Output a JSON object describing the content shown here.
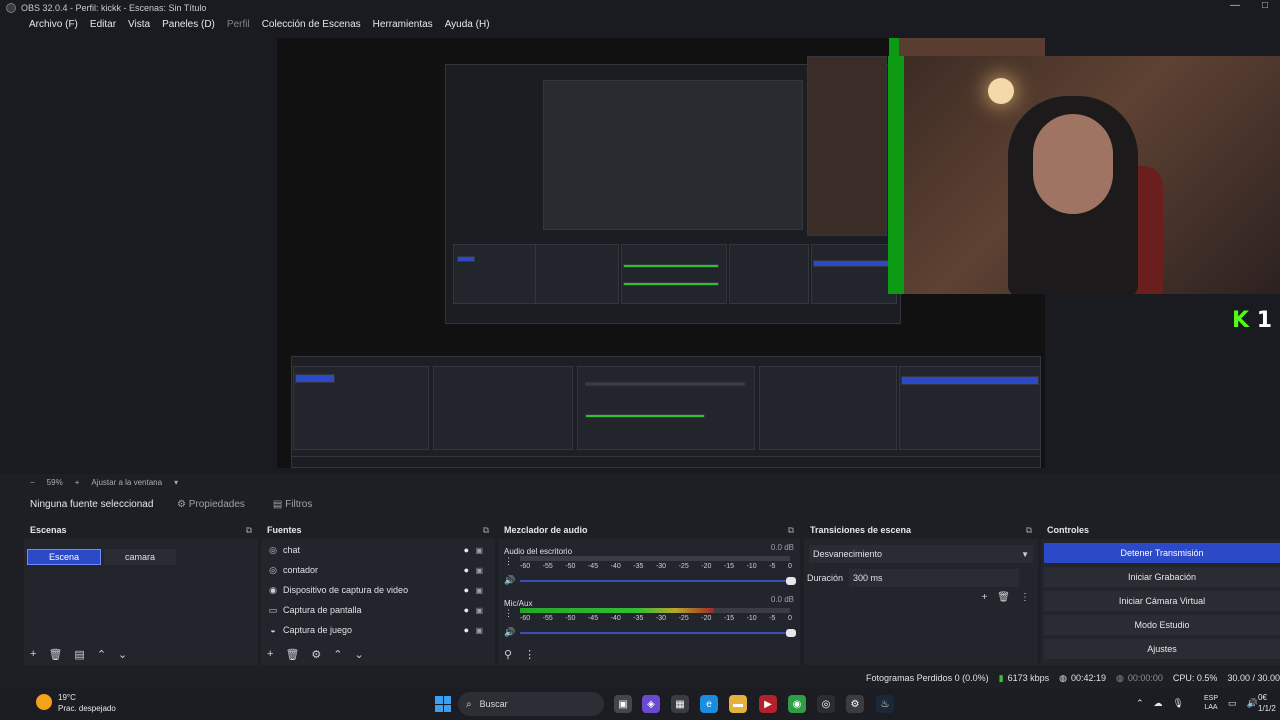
{
  "window": {
    "title": "OBS 32.0.4 - Perfil: kickk - Escenas: Sin Título"
  },
  "menu": [
    "Archivo (F)",
    "Editar",
    "Vista",
    "Paneles (D)",
    "Perfil",
    "Colección de Escenas",
    "Herramientas",
    "Ayuda (H)"
  ],
  "preview": {
    "overlay_logo_k": "K",
    "overlay_logo_num": "1"
  },
  "zoom": {
    "minus": "−",
    "percent": "59%",
    "plus": "+",
    "fit": "Ajustar a la ventana",
    "dropdown": "▾"
  },
  "source_toolbar": {
    "no_source": "Ninguna fuente seleccionad",
    "properties": "Propiedades",
    "filters": "Filtros"
  },
  "docks": {
    "scenes": {
      "title": "Escenas",
      "items": [
        "Escena",
        "camara"
      ],
      "active_index": 0
    },
    "sources": {
      "title": "Fuentes",
      "items": [
        {
          "label": "chat",
          "icon": "browser-icon"
        },
        {
          "label": "contador",
          "icon": "browser-icon"
        },
        {
          "label": "Dispositivo de captura de video",
          "icon": "camera-icon"
        },
        {
          "label": "Captura de pantalla",
          "icon": "monitor-icon"
        },
        {
          "label": "Captura de juego",
          "icon": "gamepad-icon"
        }
      ]
    },
    "mixer": {
      "title": "Mezclador de audio",
      "ticks": [
        "-60",
        "-55",
        "-50",
        "-45",
        "-40",
        "-35",
        "-30",
        "-25",
        "-20",
        "-15",
        "-10",
        "-5",
        "0"
      ],
      "tracks": [
        {
          "name": "Audio del escritorio",
          "db": "0.0 dB",
          "level": 0.0
        },
        {
          "name": "Mic/Aux",
          "db": "0.0 dB",
          "level": 0.72
        }
      ]
    },
    "transitions": {
      "title": "Transiciones de escena",
      "selected": "Desvanecimiento",
      "duration_label": "Duración",
      "duration_value": "300 ms"
    },
    "controls": {
      "title": "Controles",
      "buttons": [
        "Detener Transmisión",
        "Iniciar Grabación",
        "Iniciar Cámara Virtual",
        "Modo Estudio",
        "Ajustes"
      ]
    }
  },
  "status": {
    "dropped": "Fotogramas Perdidos 0 (0.0%)",
    "bitrate": "6173 kbps",
    "stream_time": "00:42:19",
    "rec_time": "00:00:00",
    "cpu": "CPU: 0.5%",
    "fps": "30.00 / 30.00"
  },
  "taskbar": {
    "weather_temp": "19°C",
    "weather_desc": "Prac. despejado",
    "search": "Buscar",
    "lang1": "ESP",
    "lang2": "LAA",
    "time": "0€",
    "date": "1/1/2"
  },
  "colors": {
    "accent": "#2c49c8",
    "meter_green": "#2fbf33",
    "kick_green": "#53fc18"
  }
}
